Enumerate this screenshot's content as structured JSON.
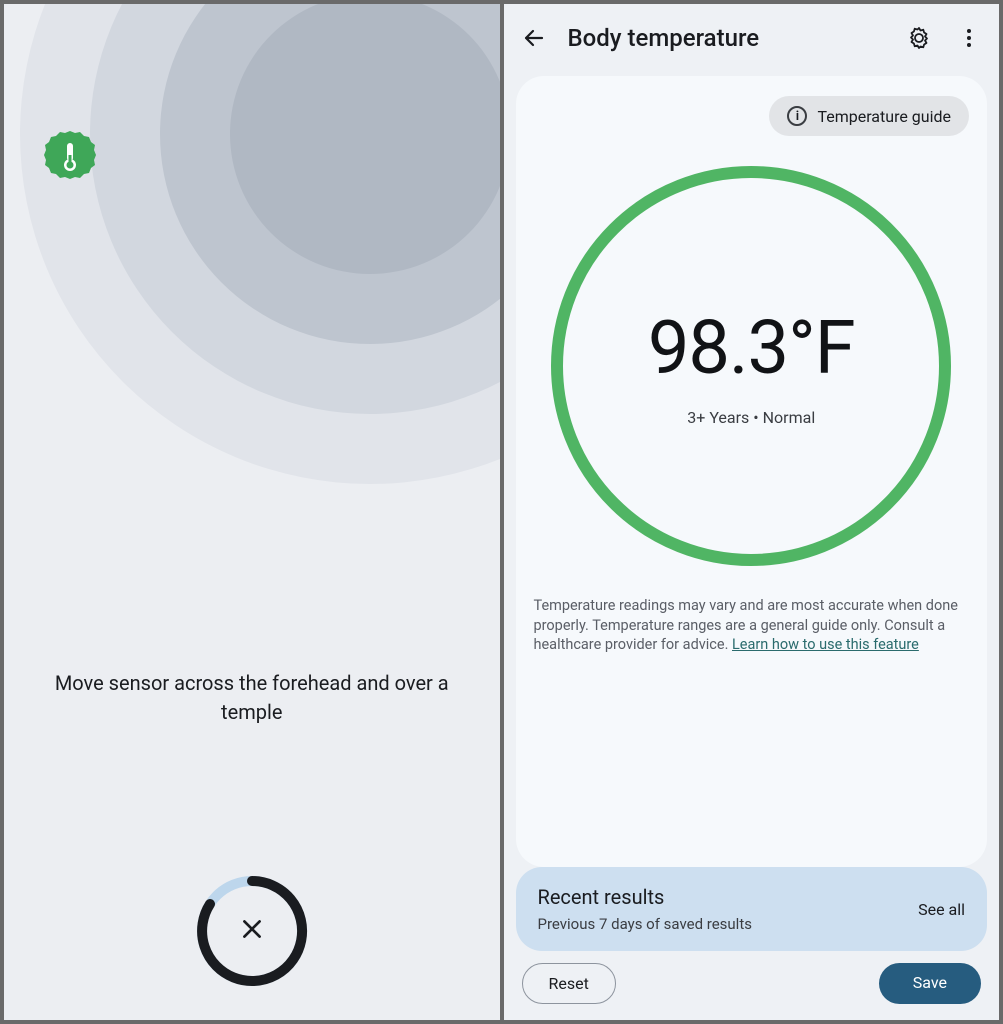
{
  "left": {
    "instruction": "Move sensor across the forehead and over a temple",
    "cancel_icon": "close",
    "badge_icon": "thermometer"
  },
  "right": {
    "header": {
      "back_icon": "arrow-left",
      "title": "Body temperature",
      "settings_icon": "gear",
      "more_icon": "more-vert"
    },
    "guide_chip": {
      "icon": "info",
      "label": "Temperature guide"
    },
    "reading": {
      "value": "98.3°F",
      "subtext": "3+ Years • Normal",
      "ring_color": "#50b564"
    },
    "disclaimer": {
      "body": "Temperature readings may vary and are most accurate when done properly. Temperature ranges are a general guide only. Consult a healthcare provider for advice. ",
      "link": "Learn how to use this feature"
    },
    "recent": {
      "title": "Recent results",
      "subtitle": "Previous 7 days of saved results",
      "see_all": "See all"
    },
    "buttons": {
      "reset": "Reset",
      "save": "Save"
    }
  }
}
